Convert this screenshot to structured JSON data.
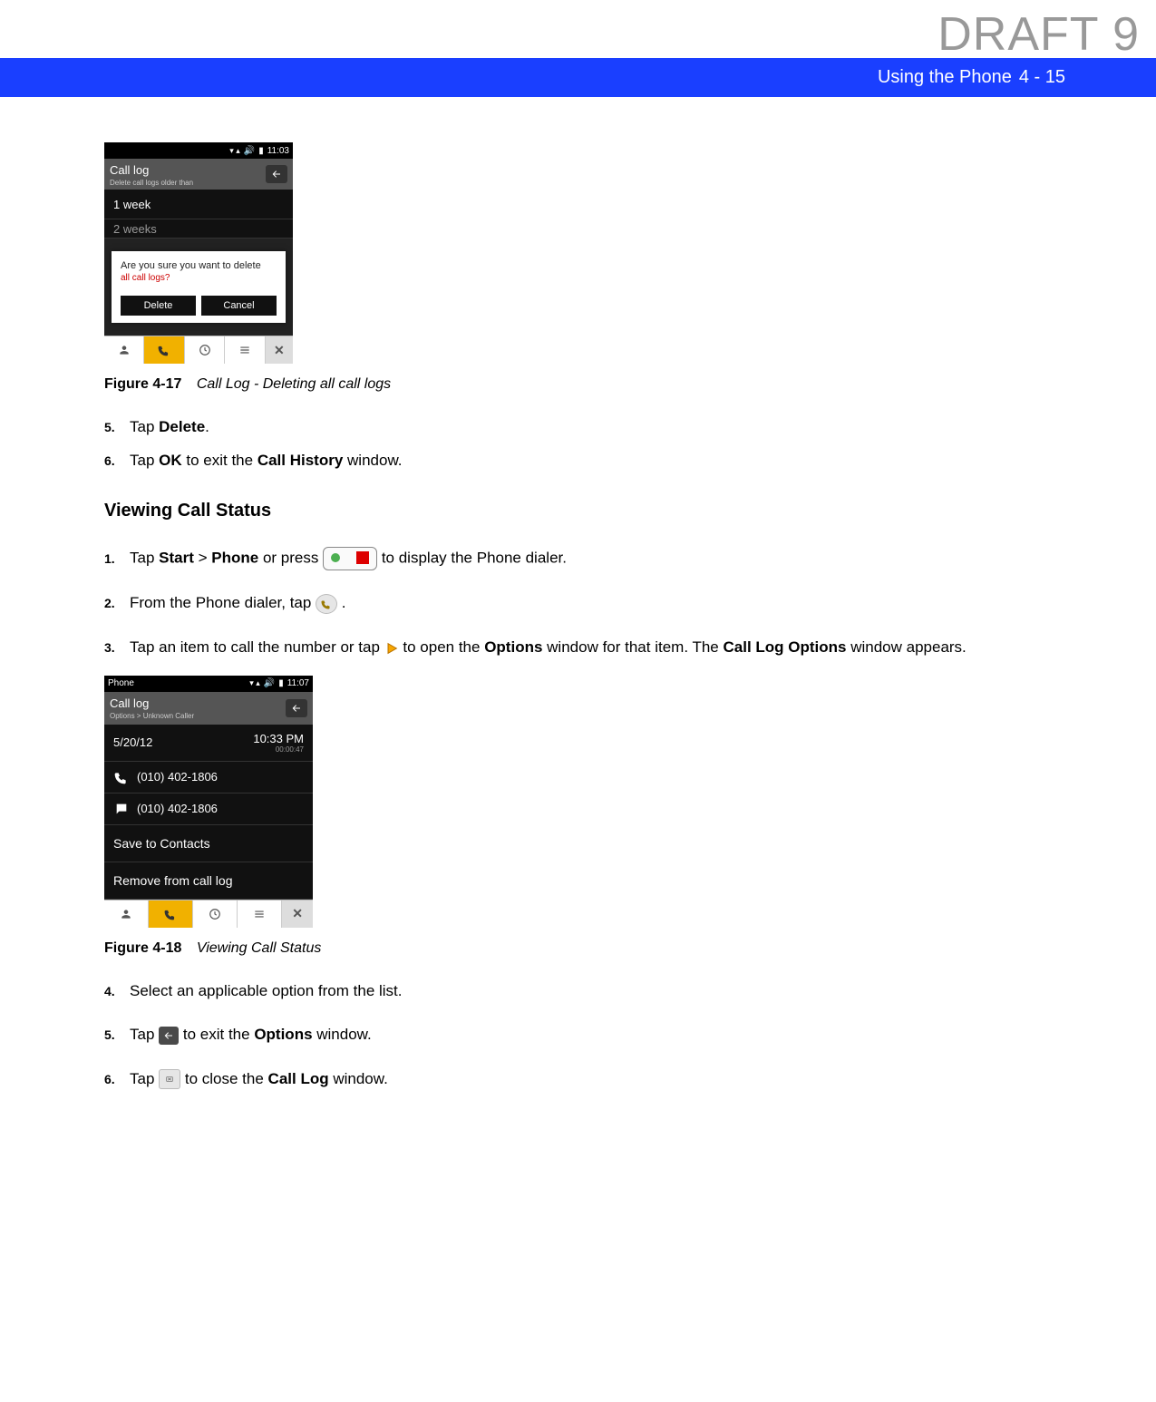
{
  "watermark": "DRAFT 9",
  "header": {
    "title": "Using the Phone",
    "page": "4 - 15"
  },
  "figure17": {
    "label": "Figure 4-17",
    "title": "Call Log - Deleting all call logs",
    "screen": {
      "time": "11:03",
      "header_title": "Call log",
      "header_sub": "Delete call logs older than",
      "row1": "1 week",
      "row2_partial": "2 weeks",
      "modal_q": "Are you sure you want to delete",
      "modal_r": "all call logs?",
      "btn_delete": "Delete",
      "btn_cancel": "Cancel"
    }
  },
  "steps_a": [
    {
      "n": "5.",
      "pre": "Tap ",
      "b1": "Delete",
      "post": "."
    },
    {
      "n": "6.",
      "pre": "Tap ",
      "b1": "OK",
      "mid": " to exit the ",
      "b2": "Call History",
      "post": " window."
    }
  ],
  "section_title": "Viewing Call Status",
  "steps_b": {
    "s1": {
      "n": "1.",
      "pre": "Tap ",
      "b1": "Start",
      "gt": " > ",
      "b2": "Phone",
      "mid": " or press ",
      "post": " to display the Phone dialer."
    },
    "s2": {
      "n": "2.",
      "pre": "From the Phone dialer, tap ",
      "post": " ."
    },
    "s3": {
      "n": "3.",
      "pre": "Tap an item to call the number or tap ",
      "mid": " to open the ",
      "b1": "Options",
      "mid2": " window for that item. The ",
      "b2": "Call Log Options",
      "post": " window appears."
    }
  },
  "figure18": {
    "label": "Figure 4-18",
    "title": "Viewing Call Status",
    "screen": {
      "title_left": "Phone",
      "time": "11:07",
      "header_title": "Call log",
      "header_sub": "Options > Unknown Caller",
      "date": "5/20/12",
      "timestamp": "10:33 PM",
      "duration": "00:00:47",
      "number1": "(010) 402-1806",
      "number2": "(010) 402-1806",
      "opt1": "Save to Contacts",
      "opt2": "Remove from call log"
    }
  },
  "steps_c": {
    "s4": {
      "n": "4.",
      "txt": "Select an applicable option from the list."
    },
    "s5": {
      "n": "5.",
      "pre": "Tap ",
      "mid": " to exit the ",
      "b1": "Options",
      "post": " window."
    },
    "s6": {
      "n": "6.",
      "pre": "Tap ",
      "mid": " to close the ",
      "b1": "Call Log",
      "post": " window."
    }
  }
}
